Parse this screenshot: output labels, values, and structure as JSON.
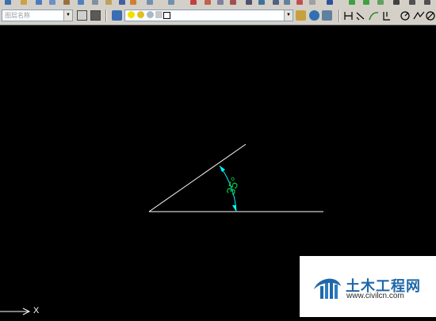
{
  "toolbar": {
    "layer_combo_text": "图层名称",
    "layer_state_text": "",
    "colors": {
      "bulb": "#f2e000",
      "sun": "#e0c020",
      "icon_blue": "#2b5ea7"
    }
  },
  "canvas": {
    "background": "#000000",
    "line_color": "#ffffff",
    "dim_color": "#00ffff",
    "dim_text_color": "#00cc44",
    "dimension_text": "35°"
  },
  "ucs": {
    "label": "X"
  },
  "watermark": {
    "title": "土木工程网",
    "url": "www.civilcn.com"
  }
}
